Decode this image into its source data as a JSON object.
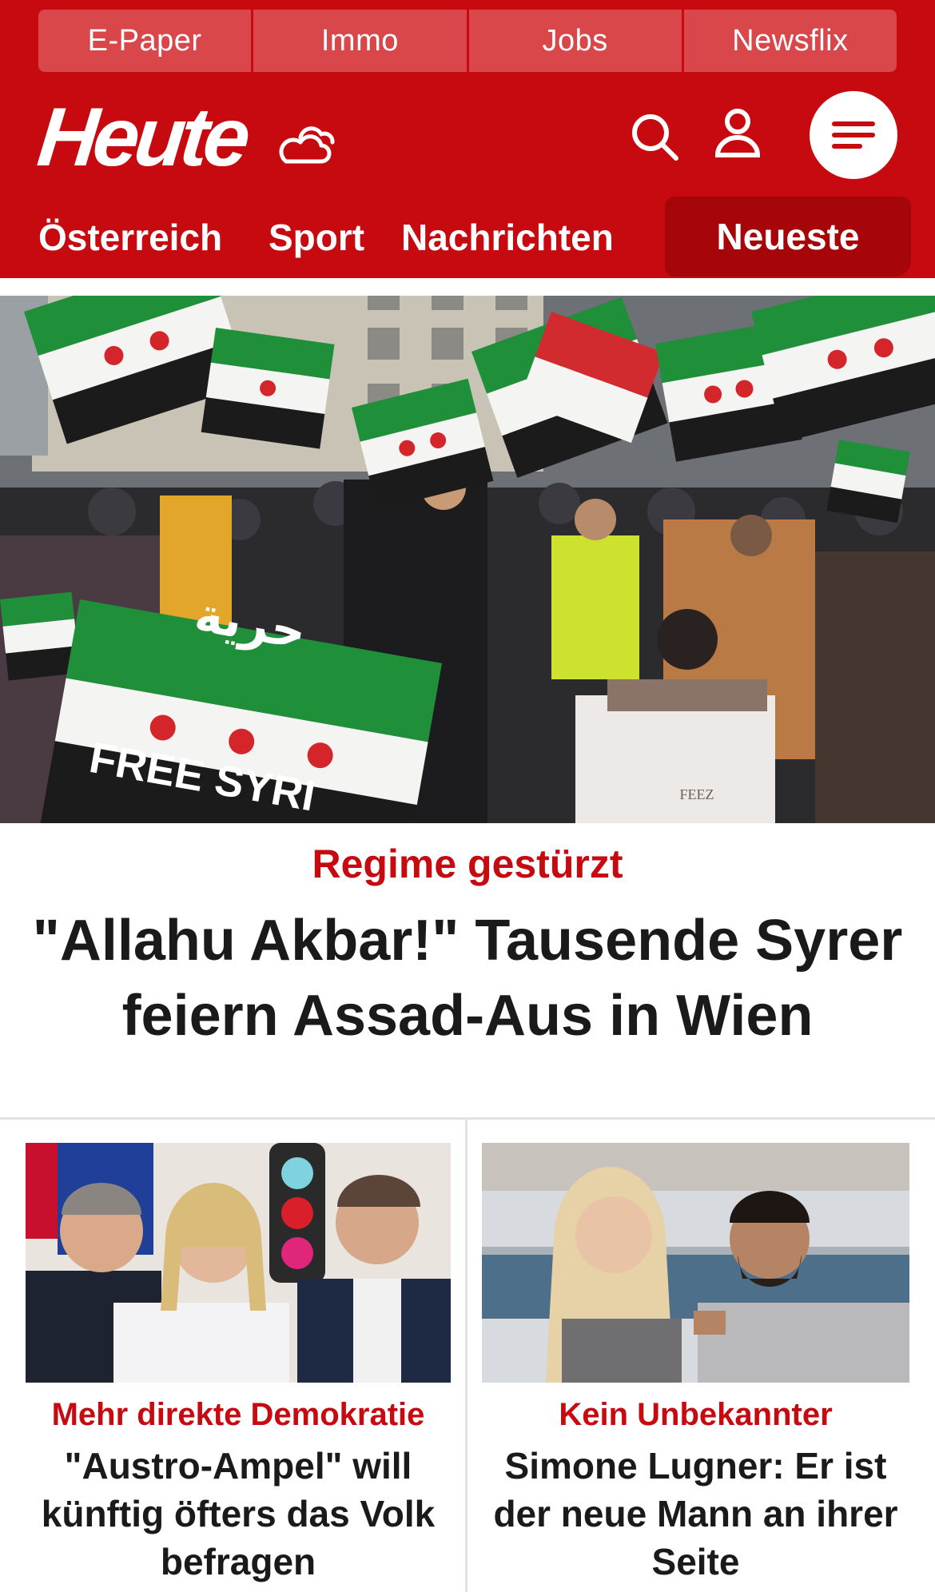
{
  "topnav": {
    "items": [
      "E-Paper",
      "Immo",
      "Jobs",
      "Newsflix"
    ]
  },
  "brand": {
    "logo_text": "Heute",
    "weather_icon": "cloud-sun-icon",
    "search_icon": "search-icon",
    "user_icon": "user-icon",
    "menu_icon": "hamburger-icon"
  },
  "sections": {
    "items": [
      "Österreich",
      "Sport",
      "Nachrichten"
    ],
    "active": "Neueste"
  },
  "hero": {
    "kicker": "Regime gestürzt",
    "headline": "\"Allahu Akbar!\" Tausende Syrer feiern Assad-Aus in Wien",
    "image_flag_text_1": "حرية",
    "image_flag_text_2": "FREE SYRI",
    "image_jacket_text": "FEEZ"
  },
  "cards": [
    {
      "kicker": "Mehr direkte Demokratie",
      "headline": "\"Austro-Ampel\" will künftig öfters das Volk befragen"
    },
    {
      "kicker": "Kein Unbekannter",
      "headline": "Simone Lugner: Er ist der neue Mann an ihrer Seite"
    }
  ],
  "colors": {
    "brand_red": "#c70a0f",
    "active_tab": "#a6050a",
    "topnav_bg": "#d9474b",
    "text_dark": "#1a1a1a"
  }
}
